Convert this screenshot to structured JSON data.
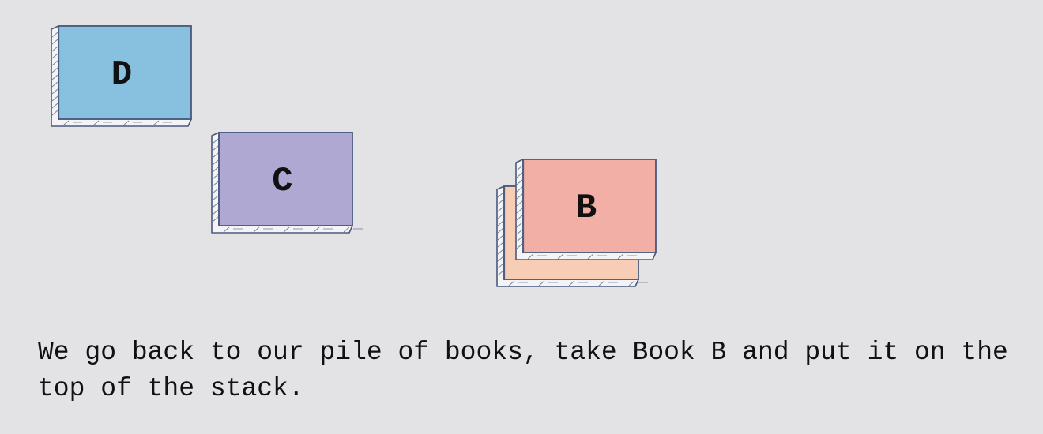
{
  "books": [
    {
      "id": "D",
      "label": "D",
      "color": "#88c0df",
      "in_stack": false,
      "label_visible": true
    },
    {
      "id": "C",
      "label": "C",
      "color": "#afa8d3",
      "in_stack": false,
      "label_visible": true
    },
    {
      "id": "stack-bottom",
      "label": "",
      "color": "#f8cdb5",
      "in_stack": true,
      "label_visible": false
    },
    {
      "id": "B",
      "label": "B",
      "color": "#f1afa6",
      "in_stack": true,
      "label_visible": true
    }
  ],
  "outline_color": "#4a5a7e",
  "page_edge_color": "#f4f4f6",
  "caption": "We go back to our pile of books, take Book B and put it on the top of the stack."
}
